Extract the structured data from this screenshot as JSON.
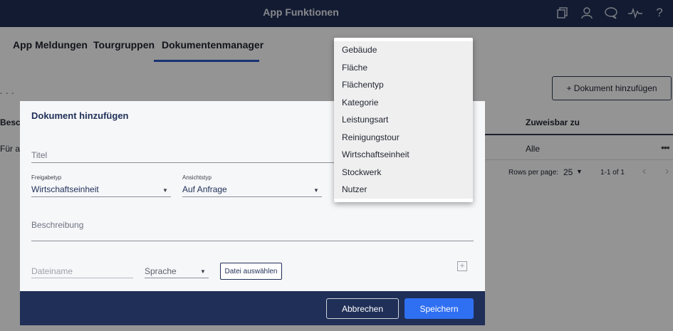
{
  "app": {
    "title": "App Funktionen"
  },
  "header_icons": [
    "copy-icon",
    "user-icon",
    "chat-icon",
    "activity-icon",
    "help-icon"
  ],
  "header_help_glyph": "?",
  "tabs": [
    {
      "label": "App Meldungen"
    },
    {
      "label": "Tourgruppen"
    },
    {
      "label": "Dokumentenmanager",
      "active": true
    }
  ],
  "background": {
    "dashes": "- - -",
    "add_button": "+ Dokument hinzufügen",
    "col_beschreibung": "Besch",
    "col_zuweisbar": "Zuweisbar zu",
    "row_beschreibung": "Für all",
    "row_zuweisbar": "Alle",
    "row_more": "•••",
    "pagination": {
      "rows_label": "Rows per page:",
      "size": "25",
      "range": "1-1 of 1"
    }
  },
  "dialog": {
    "title": "Dokument hinzufügen",
    "titel_placeholder": "Titel",
    "freigabetyp": {
      "label": "Freigabetyp",
      "value": "Wirtschaftseinheit"
    },
    "ansichtstyp": {
      "label": "Ansichtstyp",
      "value": "Auf Anfrage"
    },
    "beschreibung_placeholder": "Beschreibung",
    "dateiname_placeholder": "Dateiname",
    "sprache_placeholder": "Sprache",
    "file_button": "Datei auswählen",
    "cancel": "Abbrechen",
    "save": "Speichern"
  },
  "dropdown": {
    "items": [
      "Gebäude",
      "Fläche",
      "Flächentyp",
      "Kategorie",
      "Leistungsart",
      "Reinigungstour",
      "Wirtschaftseinheit",
      "Stockwerk",
      "Nutzer"
    ]
  },
  "colors": {
    "header": "#1f2f57",
    "accent": "#2f6ff2",
    "tab_underline": "#2d57c7"
  }
}
